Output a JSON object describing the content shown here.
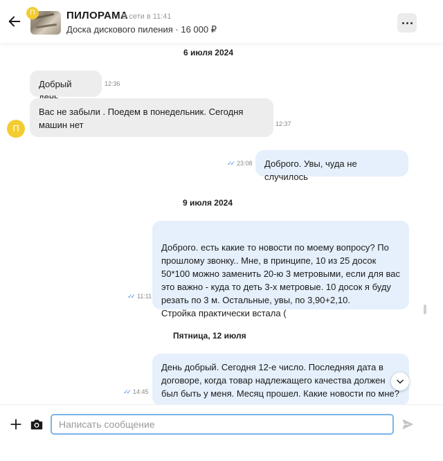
{
  "header": {
    "avatar_letter": "П",
    "title": "ПИЛОРАМА",
    "status": "В сети в 11:41",
    "subtitle": "Доска дискового пиления · 16 000 ₽"
  },
  "chat": {
    "dates": [
      "6 июля 2024",
      "9 июля 2024",
      "Пятница, 12 июля"
    ],
    "messages": [
      {
        "direction": "in",
        "text": "Добрый день",
        "time": "12:36"
      },
      {
        "direction": "in",
        "text": "Вас не забыли . Поедем в понедельник. Сегодня машин нет",
        "time": "12:37"
      },
      {
        "direction": "out",
        "text": "Доброго. Увы, чуда не случилось",
        "time": "23:08"
      },
      {
        "direction": "out",
        "text": "Доброго. есть какие то новости по моему вопросу? По прошлому звонку.. Мне, в принципе, 10 из 25 досок 50*100 можно заменить 20-ю 3 метровыми, если для вас это важно - куда то деть 3-х метровые. 10 досок я буду резать по 3 м. Остальные, увы, по 3,90+2,10.\nСтройка практически встала (",
        "time": "11:11"
      },
      {
        "direction": "out",
        "text": "День добрый. Сегодня 12-е число. Последняя дата в договоре, когда товар надлежащего качества должен был быть у меня. Месяц прошел. Какие новости по мне?",
        "time": "14:45"
      }
    ]
  },
  "composer": {
    "placeholder": "Написать сообщение"
  },
  "icons": {
    "back": "arrow-left-icon",
    "more": "more-dots-icon",
    "plus": "plus-icon",
    "camera": "camera-icon",
    "send": "send-icon",
    "scroll_down": "chevron-down-icon",
    "read": "double-check-icon"
  },
  "colors": {
    "avatar": "#f3cc30",
    "incoming_bubble": "#ededed",
    "outgoing_bubble": "#e5f0fc",
    "read_ticks": "#4a8fe0",
    "input_border": "#7ab4ea"
  }
}
